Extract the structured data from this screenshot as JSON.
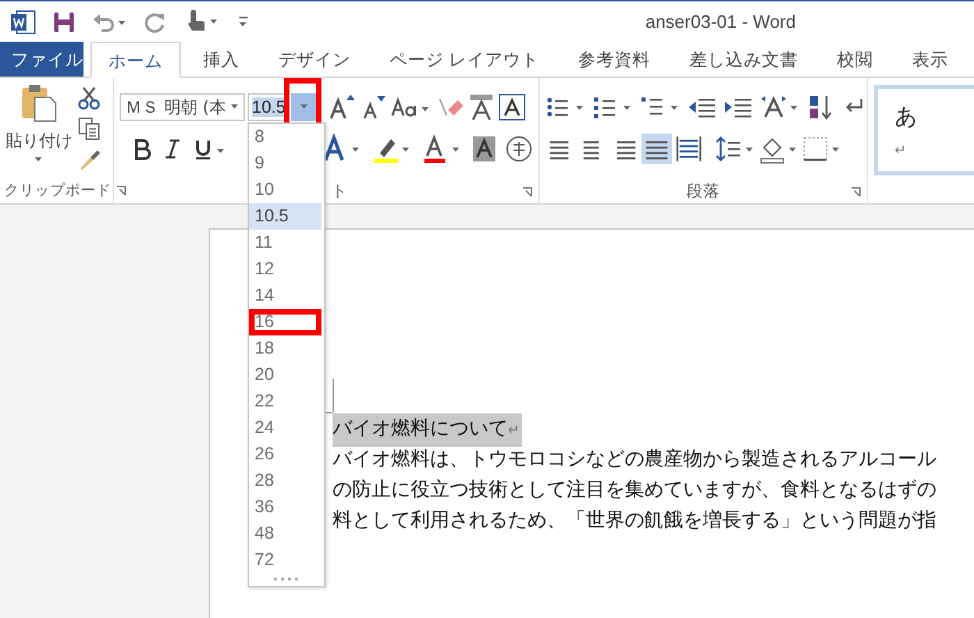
{
  "window": {
    "title": "anser03-01 - Word"
  },
  "tabs": [
    {
      "label": "ファイル",
      "kind": "file",
      "selected": false
    },
    {
      "label": "ホーム",
      "kind": "tab",
      "selected": true
    },
    {
      "label": "挿入",
      "kind": "tab",
      "selected": false
    },
    {
      "label": "デザイン",
      "kind": "tab",
      "selected": false
    },
    {
      "label": "ページ レイアウト",
      "kind": "tab",
      "selected": false
    },
    {
      "label": "参考資料",
      "kind": "tab",
      "selected": false
    },
    {
      "label": "差し込み文書",
      "kind": "tab",
      "selected": false
    },
    {
      "label": "校閲",
      "kind": "tab",
      "selected": false
    },
    {
      "label": "表示",
      "kind": "tab",
      "selected": false
    }
  ],
  "ribbon": {
    "clipboard": {
      "paste_label": "貼り付け",
      "group_label": "クリップボード"
    },
    "font": {
      "font_name": "ＭＳ 明朝 (本",
      "font_size": "10.5",
      "size_dropdown_marked": true,
      "group_label": "ト"
    },
    "paragraph": {
      "group_label": "段落",
      "alignments": [
        {
          "kind": "left",
          "selected": false
        },
        {
          "kind": "center",
          "selected": false
        },
        {
          "kind": "right",
          "selected": false
        },
        {
          "kind": "justify",
          "selected": true
        },
        {
          "kind": "distributed",
          "selected": false
        }
      ]
    },
    "styles": {
      "preview": "あ",
      "mark": "↵"
    }
  },
  "font_size_list": [
    {
      "label": "8",
      "selected": false,
      "marked": false
    },
    {
      "label": "9",
      "selected": false,
      "marked": false
    },
    {
      "label": "10",
      "selected": false,
      "marked": false
    },
    {
      "label": "10.5",
      "selected": true,
      "marked": false
    },
    {
      "label": "11",
      "selected": false,
      "marked": false
    },
    {
      "label": "12",
      "selected": false,
      "marked": false
    },
    {
      "label": "14",
      "selected": false,
      "marked": false
    },
    {
      "label": "16",
      "selected": false,
      "marked": true
    },
    {
      "label": "18",
      "selected": false,
      "marked": false
    },
    {
      "label": "20",
      "selected": false,
      "marked": false
    },
    {
      "label": "22",
      "selected": false,
      "marked": false
    },
    {
      "label": "24",
      "selected": false,
      "marked": false
    },
    {
      "label": "26",
      "selected": false,
      "marked": false
    },
    {
      "label": "28",
      "selected": false,
      "marked": false
    },
    {
      "label": "36",
      "selected": false,
      "marked": false
    },
    {
      "label": "48",
      "selected": false,
      "marked": false
    },
    {
      "label": "72",
      "selected": false,
      "marked": false
    }
  ],
  "document": {
    "heading": {
      "text": "バイオ燃料について",
      "selected": true,
      "paragraph_mark": "↵"
    },
    "lines": [
      "バイオ燃料は、トウモロコシなどの農産物から製造されるアルコール",
      "の防止に役立つ技術として注目を集めていますが、食料となるはずの",
      "料として利用されるため、「世界の飢餓を増長する」という問題が指"
    ]
  }
}
